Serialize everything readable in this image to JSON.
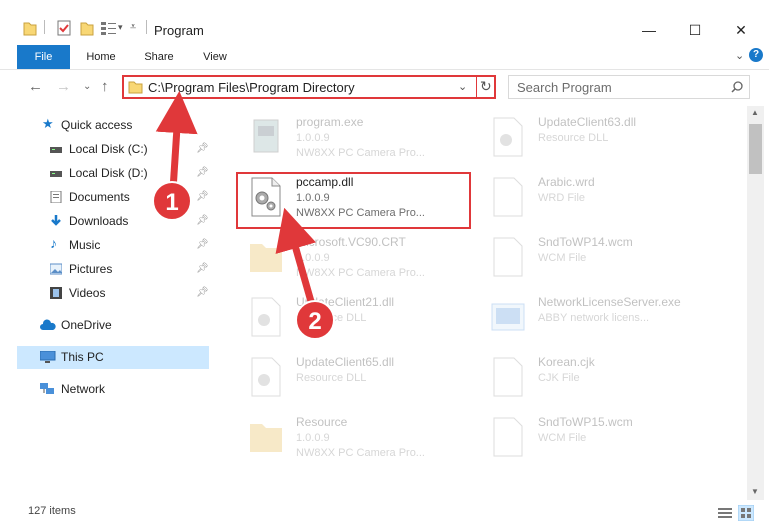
{
  "window": {
    "title": "Program",
    "minimize_glyph": "—",
    "maximize_glyph": "☐",
    "close_glyph": "✕"
  },
  "ribbon": {
    "tabs": [
      "File",
      "Home",
      "Share",
      "View"
    ]
  },
  "nav": {
    "address": "C:\\Program Files\\Program Directory",
    "search_placeholder": "Search Program"
  },
  "sidebar": {
    "items": [
      {
        "label": "Quick access",
        "icon": "star-icon"
      },
      {
        "label": "Local Disk (C:)",
        "icon": "drive-icon",
        "pinned": true
      },
      {
        "label": "Local Disk (D:)",
        "icon": "drive-icon",
        "pinned": true
      },
      {
        "label": "Documents",
        "icon": "documents-icon",
        "pinned": true
      },
      {
        "label": "Downloads",
        "icon": "download-icon",
        "pinned": true
      },
      {
        "label": "Music",
        "icon": "music-icon",
        "pinned": true
      },
      {
        "label": "Pictures",
        "icon": "pictures-icon",
        "pinned": true
      },
      {
        "label": "Videos",
        "icon": "videos-icon",
        "pinned": true
      },
      {
        "label": "OneDrive",
        "icon": "cloud-icon"
      },
      {
        "label": "This PC",
        "icon": "computer-icon",
        "selected": true
      },
      {
        "label": "Network",
        "icon": "network-icon"
      }
    ]
  },
  "files": [
    {
      "name": "program.exe",
      "line1": "1.0.0.9",
      "line2": "NW8XX PC Camera Pro...",
      "icon": "exe-icon"
    },
    {
      "name": "UpdateClient63.dll",
      "line1": "Resource DLL",
      "line2": "",
      "icon": "dll-icon"
    },
    {
      "name": "pccamp.dll",
      "line1": "1.0.0.9",
      "line2": "NW8XX PC Camera Pro...",
      "icon": "dll-icon",
      "highlighted": true
    },
    {
      "name": "Arabic.wrd",
      "line1": "WRD File",
      "line2": "",
      "icon": "file-icon"
    },
    {
      "name": "Microsoft.VC90.CRT",
      "line1": "1.0.0.9",
      "line2": "NW8XX PC Camera Pro...",
      "icon": "folder-icon"
    },
    {
      "name": "SndToWP14.wcm",
      "line1": "WCM File",
      "line2": "",
      "icon": "file-icon"
    },
    {
      "name": "UpdateClient21.dll",
      "line1": "Resource DLL",
      "line2": "",
      "icon": "dll-icon"
    },
    {
      "name": "NetworkLicenseServer.exe",
      "line1": "ABBY network licens...",
      "line2": "",
      "icon": "exe-icon"
    },
    {
      "name": "UpdateClient65.dll",
      "line1": "Resource DLL",
      "line2": "",
      "icon": "dll-icon"
    },
    {
      "name": "Korean.cjk",
      "line1": "CJK File",
      "line2": "",
      "icon": "file-icon"
    },
    {
      "name": "Resource",
      "line1": "1.0.0.9",
      "line2": "NW8XX PC Camera Pro...",
      "icon": "folder-icon"
    },
    {
      "name": "SndToWP15.wcm",
      "line1": "WCM File",
      "line2": "",
      "icon": "file-icon"
    }
  ],
  "status": {
    "item_count": "127 items"
  },
  "annotations": {
    "step1": "1",
    "step2": "2"
  },
  "colors": {
    "accent": "#1979ca",
    "highlight_red": "#e0383a",
    "selected_bg": "#cce8ff"
  }
}
